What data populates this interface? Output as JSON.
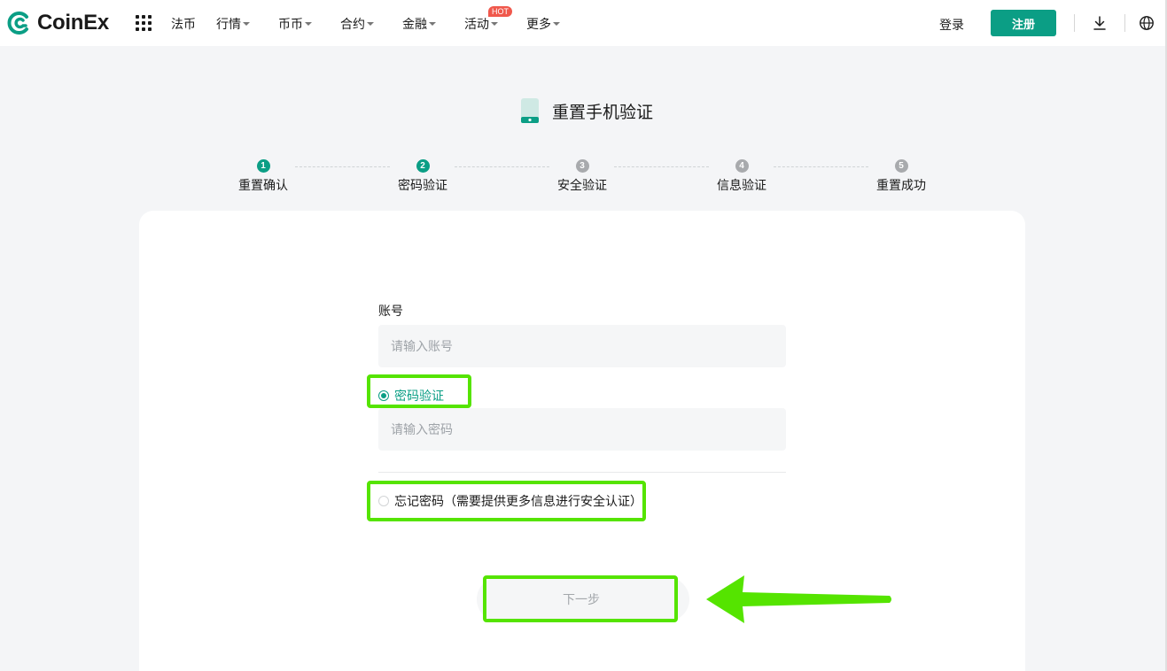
{
  "header": {
    "brand": "CoinEx",
    "nav": [
      {
        "label": "法币",
        "dropdown": false
      },
      {
        "label": "行情",
        "dropdown": true
      },
      {
        "label": "币币",
        "dropdown": true
      },
      {
        "label": "合约",
        "dropdown": true
      },
      {
        "label": "金融",
        "dropdown": true
      },
      {
        "label": "活动",
        "dropdown": true
      },
      {
        "label": "更多",
        "dropdown": true
      }
    ],
    "hot_badge": "HOT",
    "login": "登录",
    "register": "注册"
  },
  "page": {
    "title": "重置手机验证"
  },
  "steps": [
    {
      "num": "1",
      "label": "重置确认",
      "state": "active"
    },
    {
      "num": "2",
      "label": "密码验证",
      "state": "active"
    },
    {
      "num": "3",
      "label": "安全验证",
      "state": "inactive"
    },
    {
      "num": "4",
      "label": "信息验证",
      "state": "inactive"
    },
    {
      "num": "5",
      "label": "重置成功",
      "state": "inactive"
    }
  ],
  "form": {
    "account_label": "账号",
    "account_placeholder": "请输入账号",
    "option_password": "密码验证",
    "password_placeholder": "请输入密码",
    "option_forgot": "忘记密码（需要提供更多信息进行安全认证）",
    "next_button": "下一步"
  },
  "colors": {
    "brand": "#0b9e85",
    "highlight": "#55e400",
    "hot": "#f0584c"
  }
}
